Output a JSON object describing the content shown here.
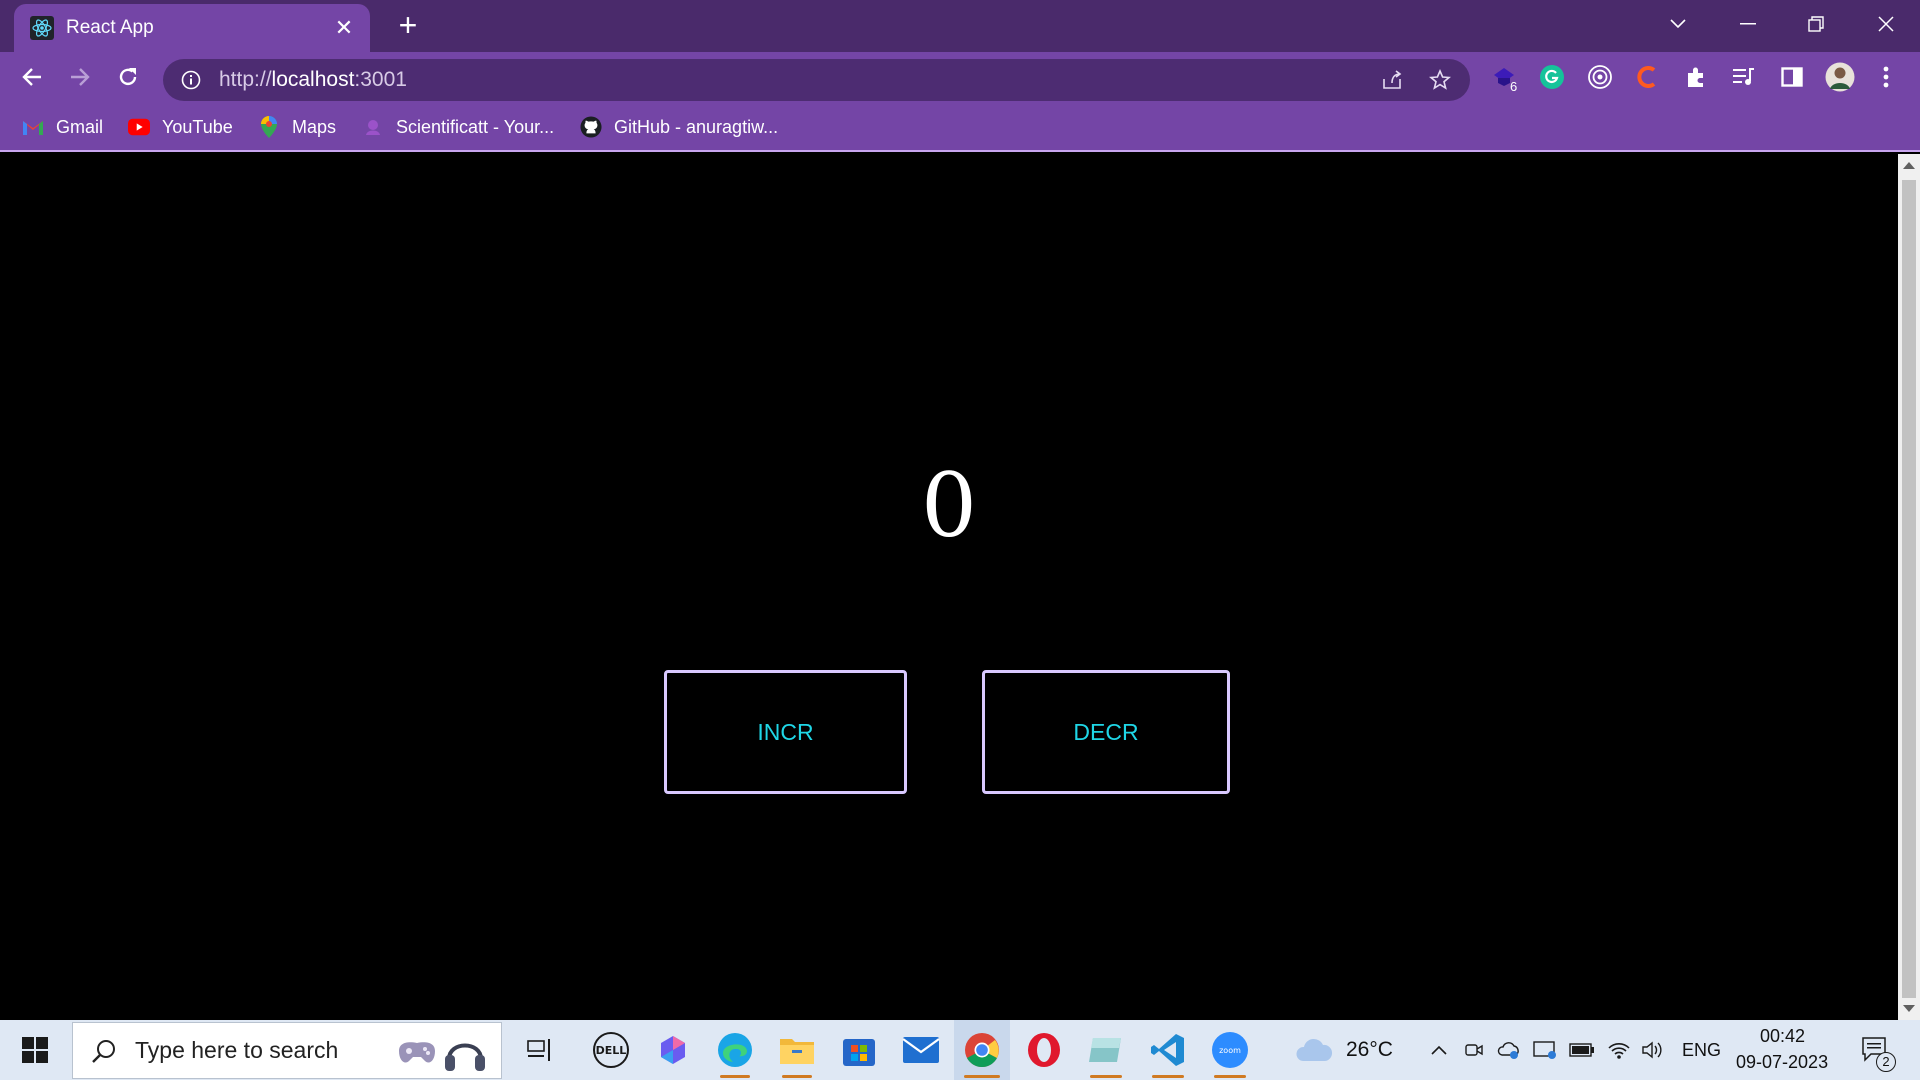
{
  "browser": {
    "tab": {
      "title": "React App",
      "favicon": "react-icon"
    },
    "url": {
      "protocol": "http://",
      "host": "localhost",
      "port": ":3001"
    },
    "bookmarks": [
      {
        "label": "Gmail",
        "icon": "gmail-icon"
      },
      {
        "label": "YouTube",
        "icon": "youtube-icon"
      },
      {
        "label": "Maps",
        "icon": "maps-icon"
      },
      {
        "label": "Scientificatt - Your...",
        "icon": "scientificatt-icon"
      },
      {
        "label": "GitHub - anuragtiw...",
        "icon": "github-icon"
      }
    ],
    "extension_badge": "6"
  },
  "app": {
    "count": "0",
    "increment_label": "INCR",
    "decrement_label": "DECR"
  },
  "taskbar": {
    "search_placeholder": "Type here to search",
    "weather": "26°C",
    "language": "ENG",
    "time": "00:42",
    "date": "09-07-2023",
    "notifications": "2"
  },
  "colors": {
    "tab_strip": "#4a2a6b",
    "toolbar": "#7445a6",
    "button_text": "#1fd6e6",
    "button_border": "#d9c9ff"
  }
}
